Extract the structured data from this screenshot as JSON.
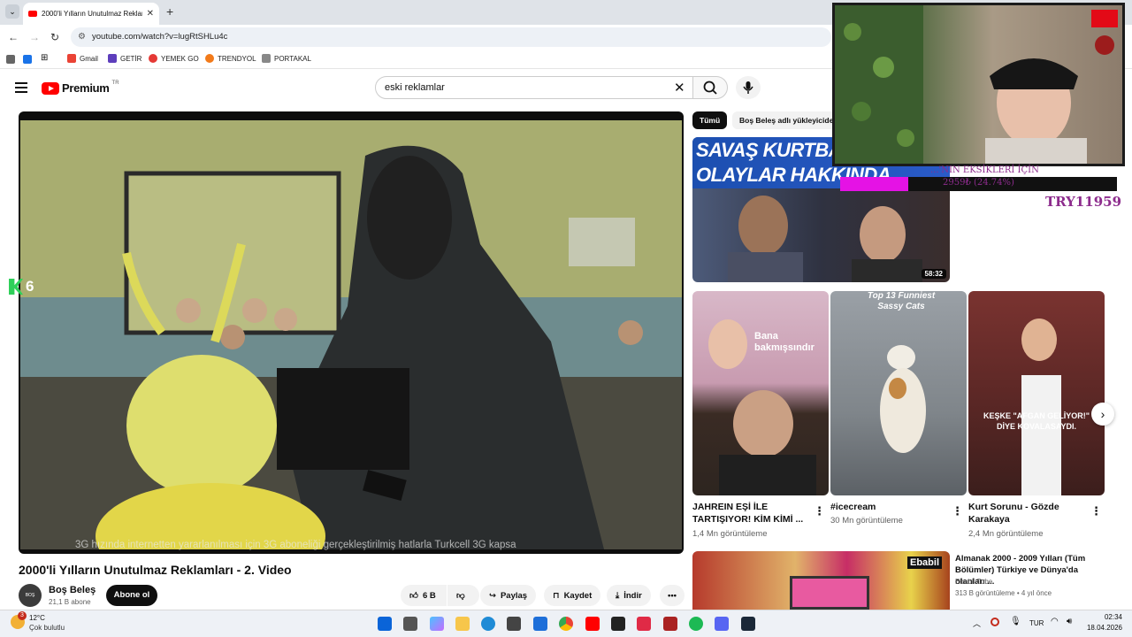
{
  "browser": {
    "tab_title": "2000'li Yılların Unutulmaz Reklamları - 2. Video - YouTube",
    "url": "youtube.com/watch?v=lugRtSHLu4c",
    "bookmarks": [
      "Gmail",
      "GETİR",
      "YEMEK GO",
      "TRENDYOL",
      "PORTAKAL"
    ]
  },
  "youtube": {
    "logo": "Premium",
    "region": "TR",
    "search_value": "eski reklamlar"
  },
  "video": {
    "title": "2000'li Yılların Unutulmaz Reklamları - 2. Video",
    "subtitle_burned": "3G hızında internetten yararlanılması için 3G aboneliği gerçekleştirilmiş hatlarla Turkcell 3G kapsa",
    "overlay_counter": "6",
    "channel_name": "Boş Beleş",
    "channel_avatar": "BOŞ BELEŞ",
    "subscribers": "21,1 B abone",
    "subscribe_label": "Abone ol",
    "likes": "6 B",
    "share_label": "Paylaş",
    "save_label": "Kaydet",
    "download_label": "İndir"
  },
  "chips": [
    "Tümü",
    "Boş Beleş adlı yükleyiciden"
  ],
  "recommendations": {
    "top": {
      "thumb_line1": "SAVAŞ KURTBA",
      "thumb_line2": "OLAYLAR HAKKINDA",
      "duration": "58:32"
    },
    "shorts": [
      {
        "title": "JAHREIN EŞİ İLE TARTIŞIYOR! KİM KİMİ ...",
        "views": "1,4 Mn görüntüleme",
        "thumb_text": "Bana bakmışsındır"
      },
      {
        "title": "#icecream",
        "views": "30 Mn görüntüleme",
        "thumb_text": "Top 13 Funniest Sassy Cats"
      },
      {
        "title": "Kurt Sorunu - Gözde Karakaya",
        "views": "2,4 Mn görüntüleme",
        "thumb_text": "KEŞKE \"AFGAN GELİYOR!\" DİYE KOVALASAYDI."
      }
    ],
    "bottom": {
      "title": "Almanak 2000 - 2009 Yılları (Tüm Bölümler) Türkiye ve Dünya'da olanları ...",
      "channel": "Ebabil Tube",
      "meta": "313 B görüntüleme • 4 yıl önce",
      "thumb_text": "Ebabil"
    }
  },
  "stream_overlay": {
    "goal_title": "...'NIN EKSİKLERİ İÇİN",
    "goal_progress": "2959₺ (24.74%)",
    "goal_fraction": 0.2474,
    "goal_target": "TRY11959"
  },
  "taskbar": {
    "temp": "12°C",
    "weather": "Çok bulutlu",
    "notification_count": "3",
    "language": "TUR",
    "time": "02:34",
    "date": "18.04.2026"
  },
  "colors": {
    "youtube_red": "#ff0000",
    "goal_magenta": "#e512e5",
    "goal_text": "#8d2c8d"
  }
}
